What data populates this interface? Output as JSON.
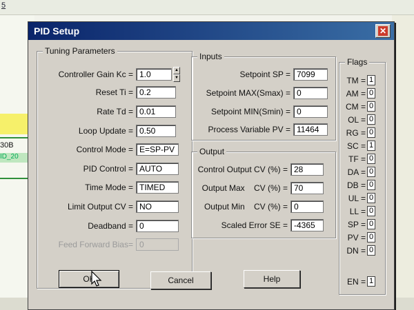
{
  "background": {
    "top_text": "5",
    "code_1": "30B",
    "code_2": "ID_20"
  },
  "dialog": {
    "title": "PID Setup",
    "close_glyph": "✕"
  },
  "tuning": {
    "legend": "Tuning Parameters",
    "fields": [
      {
        "label": "Controller Gain Kc =",
        "value": "1.0"
      },
      {
        "label": "Reset Ti =",
        "value": "0.2"
      },
      {
        "label": "Rate Td =",
        "value": "0.01"
      },
      {
        "label": "Loop Update =",
        "value": "0.50"
      },
      {
        "label": "Control Mode =",
        "value": "E=SP-PV"
      },
      {
        "label": "PID Control =",
        "value": "AUTO"
      },
      {
        "label": "Time Mode =",
        "value": "TIMED"
      },
      {
        "label": "Limit Output CV =",
        "value": "NO"
      },
      {
        "label": "Deadband =",
        "value": "0"
      },
      {
        "label": "Feed Forward Bias=",
        "value": "0"
      }
    ]
  },
  "inputs": {
    "legend": "Inputs",
    "fields": [
      {
        "label": "Setpoint SP =",
        "value": "7099"
      },
      {
        "label": "Setpoint MAX(Smax) =",
        "value": "0"
      },
      {
        "label": "Setpoint MIN(Smin) =",
        "value": "0"
      },
      {
        "label": "Process Variable PV =",
        "value": "11464"
      }
    ]
  },
  "output": {
    "legend": "Output",
    "fields": [
      {
        "label": "Control Output CV (%) =",
        "value": "28"
      },
      {
        "label": "Output Max    CV (%) =",
        "value": "70"
      },
      {
        "label": "Output Min    CV (%) =",
        "value": "0"
      },
      {
        "label": "Scaled Error SE =",
        "value": "-4365"
      }
    ]
  },
  "flags": {
    "legend": "Flags",
    "items": [
      {
        "label": "TM =",
        "value": "1"
      },
      {
        "label": "AM =",
        "value": "0"
      },
      {
        "label": "CM =",
        "value": "0"
      },
      {
        "label": "OL =",
        "value": "0"
      },
      {
        "label": "RG =",
        "value": "0"
      },
      {
        "label": "SC =",
        "value": "1"
      },
      {
        "label": "TF =",
        "value": "0"
      },
      {
        "label": "DA =",
        "value": "0"
      },
      {
        "label": "DB =",
        "value": "0"
      },
      {
        "label": "UL =",
        "value": "0"
      },
      {
        "label": "LL =",
        "value": "0"
      },
      {
        "label": "SP =",
        "value": "0"
      },
      {
        "label": "PV =",
        "value": "0"
      },
      {
        "label": "DN =",
        "value": "0"
      }
    ],
    "en": {
      "label": "EN =",
      "value": "1"
    }
  },
  "buttons": {
    "ok": "OK",
    "cancel": "Cancel",
    "help": "Help"
  },
  "icons": {
    "close": "close-icon",
    "spin_up": "chevron-up-icon",
    "spin_down": "chevron-down-icon",
    "cursor": "mouse-pointer-icon"
  },
  "colors": {
    "titlebar_start": "#0a246a",
    "titlebar_end": "#3a6ea5",
    "dialog_face": "#d4d0c8",
    "close_red": "#cc3b2b"
  }
}
